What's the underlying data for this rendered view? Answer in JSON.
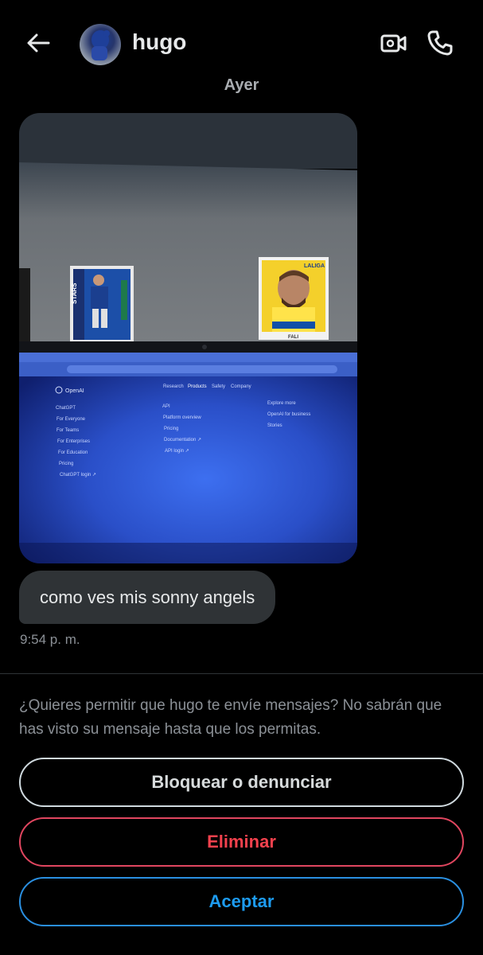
{
  "header": {
    "contact_name": "hugo",
    "back_icon": "arrow-left-icon",
    "video_icon": "video-camera-icon",
    "call_icon": "phone-icon"
  },
  "conversation": {
    "day_separator": "Ayer",
    "photo_icon": "photo-attachment",
    "message_text": "como ves mis sonny angels",
    "message_time": "9:54 p. m."
  },
  "request": {
    "prompt": "¿Quieres permitir que hugo te envíe mensajes? No sabrán que has visto su mensaje hasta que los permitas.",
    "block_label": "Bloquear o denunciar",
    "delete_label": "Eliminar",
    "accept_label": "Aceptar"
  },
  "photo_content": {
    "card_left_text": "STARS",
    "card_right_league": "LALIGA",
    "card_right_name": "FALI",
    "screen_brand": "OpenAI",
    "screen_nav": [
      "Research",
      "Products",
      "Safety",
      "Company"
    ],
    "screen_left_menu": [
      "ChatGPT",
      "For Everyone",
      "For Teams",
      "For Enterprises",
      "For Education",
      "Pricing",
      "ChatGPT login ↗"
    ],
    "screen_mid_menu": [
      "API",
      "Platform overview",
      "Pricing",
      "Documentation ↗",
      "API login ↗"
    ],
    "screen_right_menu": [
      "Explore more",
      "OpenAI for business",
      "Stories"
    ]
  },
  "colors": {
    "background": "#000000",
    "bubble": "#2f3336",
    "danger": "#f4414d",
    "accent": "#1d9bf0"
  }
}
